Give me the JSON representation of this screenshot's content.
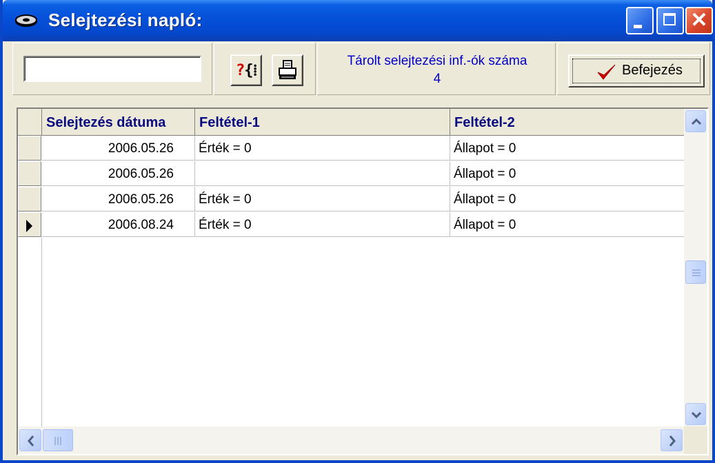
{
  "window": {
    "title": "Selejtezési napló:",
    "title_icon": "disk-icon",
    "controls": [
      "minimize-icon",
      "maximize-icon",
      "close-icon"
    ]
  },
  "toolbar": {
    "search_value": "",
    "help_icon": "?{}",
    "print_icon": "printer-icon",
    "count_label": "Tárolt selejtezési inf.-ók száma",
    "count_value": "4",
    "finish_label": "Befejezés",
    "finish_icon": "checkmark-icon"
  },
  "grid": {
    "columns": [
      "Selejtezés dátuma",
      "Feltétel-1",
      "Feltétel-2"
    ],
    "rows": [
      {
        "date": "2006.05.26",
        "cond1": "Érték = 0",
        "cond2": "Állapot = 0"
      },
      {
        "date": "2006.05.26",
        "cond1": "",
        "cond2": "Állapot = 0"
      },
      {
        "date": "2006.05.26",
        "cond1": "Érték = 0",
        "cond2": "Állapot = 0"
      },
      {
        "date": "2006.08.24",
        "cond1": "Érték = 0",
        "cond2": "Állapot = 0"
      }
    ],
    "current_row": 4
  },
  "colors": {
    "title_bar": "#0550d8",
    "header_text": "#0a0a80",
    "count_text": "#0000c8",
    "check": "#d00000"
  }
}
